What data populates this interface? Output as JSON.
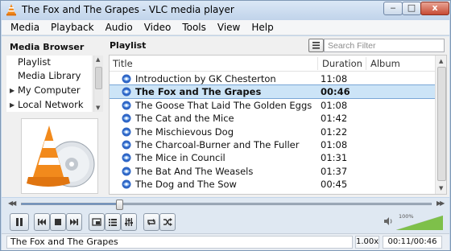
{
  "window": {
    "title": "The Fox and The Grapes - VLC media player",
    "buttons": {
      "minimize": "‒",
      "maximize": "□",
      "close": "x"
    }
  },
  "menu": [
    "Media",
    "Playback",
    "Audio",
    "Video",
    "Tools",
    "View",
    "Help"
  ],
  "sidebar": {
    "header": "Media Browser",
    "items": [
      {
        "label": "Playlist",
        "expandable": false
      },
      {
        "label": "Media Library",
        "expandable": false
      },
      {
        "label": "My Computer",
        "expandable": true
      },
      {
        "label": "Local Network",
        "expandable": true
      }
    ]
  },
  "playlist": {
    "header": "Playlist",
    "search_placeholder": "Search Filter",
    "columns": [
      "Title",
      "Duration",
      "Album"
    ],
    "rows": [
      {
        "title": "Introduction by GK Chesterton",
        "duration": "11:08",
        "selected": false
      },
      {
        "title": "The Fox and The Grapes",
        "duration": "00:46",
        "selected": true
      },
      {
        "title": "The Goose That Laid The Golden Eggs",
        "duration": "01:08",
        "selected": false
      },
      {
        "title": "The Cat and the Mice",
        "duration": "01:42",
        "selected": false
      },
      {
        "title": "The Mischievous Dog",
        "duration": "01:22",
        "selected": false
      },
      {
        "title": "The Charcoal-Burner and The Fuller",
        "duration": "01:08",
        "selected": false
      },
      {
        "title": "The Mice in Council",
        "duration": "01:31",
        "selected": false
      },
      {
        "title": "The Bat And The Weasels",
        "duration": "01:37",
        "selected": false
      },
      {
        "title": "The Dog and The Sow",
        "duration": "00:45",
        "selected": false
      }
    ]
  },
  "seek": {
    "progress_fraction": 0.239
  },
  "controls": {
    "buttons": [
      "pause-icon",
      "previous-icon",
      "stop-icon",
      "next-icon",
      "fullscreen-icon",
      "playlist-icon",
      "equalizer-icon",
      "loop-icon",
      "shuffle-icon"
    ],
    "volume_label": "100%",
    "volume_fraction": 1.0
  },
  "status": {
    "now_playing": "The Fox and The Grapes",
    "speed": "1.00x",
    "time": "00:11/00:46"
  },
  "colors": {
    "accent": "#5f8fd0",
    "selection": "#cce4f7",
    "vlc_orange": "#f28a1c",
    "volume_green": "#7ec04a"
  }
}
